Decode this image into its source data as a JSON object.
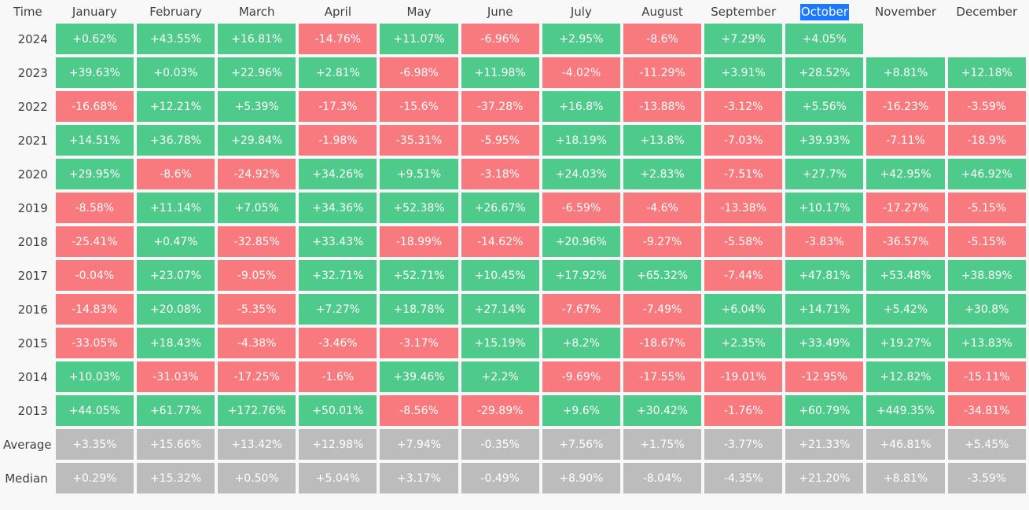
{
  "table": {
    "corner_label": "Time",
    "columns": [
      "January",
      "February",
      "March",
      "April",
      "May",
      "June",
      "July",
      "August",
      "September",
      "October",
      "November",
      "December"
    ],
    "highlighted_column": "October",
    "selection_color": "#1a79ff",
    "selection_text_color": "#ffffff",
    "positive_color": "#4ecb8a",
    "negative_color": "#f97a7e",
    "summary_color": "#bcbcbc",
    "background_color": "#f8f8f8",
    "rows": [
      {
        "label": "2024",
        "kind": "year",
        "values": [
          "+0.62%",
          "+43.55%",
          "+16.81%",
          "-14.76%",
          "+11.07%",
          "-6.96%",
          "+2.95%",
          "-8.6%",
          "+7.29%",
          "+4.05%",
          "",
          ""
        ]
      },
      {
        "label": "2023",
        "kind": "year",
        "values": [
          "+39.63%",
          "+0.03%",
          "+22.96%",
          "+2.81%",
          "-6.98%",
          "+11.98%",
          "-4.02%",
          "-11.29%",
          "+3.91%",
          "+28.52%",
          "+8.81%",
          "+12.18%"
        ]
      },
      {
        "label": "2022",
        "kind": "year",
        "values": [
          "-16.68%",
          "+12.21%",
          "+5.39%",
          "-17.3%",
          "-15.6%",
          "-37.28%",
          "+16.8%",
          "-13.88%",
          "-3.12%",
          "+5.56%",
          "-16.23%",
          "-3.59%"
        ]
      },
      {
        "label": "2021",
        "kind": "year",
        "values": [
          "+14.51%",
          "+36.78%",
          "+29.84%",
          "-1.98%",
          "-35.31%",
          "-5.95%",
          "+18.19%",
          "+13.8%",
          "-7.03%",
          "+39.93%",
          "-7.11%",
          "-18.9%"
        ]
      },
      {
        "label": "2020",
        "kind": "year",
        "values": [
          "+29.95%",
          "-8.6%",
          "-24.92%",
          "+34.26%",
          "+9.51%",
          "-3.18%",
          "+24.03%",
          "+2.83%",
          "-7.51%",
          "+27.7%",
          "+42.95%",
          "+46.92%"
        ]
      },
      {
        "label": "2019",
        "kind": "year",
        "values": [
          "-8.58%",
          "+11.14%",
          "+7.05%",
          "+34.36%",
          "+52.38%",
          "+26.67%",
          "-6.59%",
          "-4.6%",
          "-13.38%",
          "+10.17%",
          "-17.27%",
          "-5.15%"
        ]
      },
      {
        "label": "2018",
        "kind": "year",
        "values": [
          "-25.41%",
          "+0.47%",
          "-32.85%",
          "+33.43%",
          "-18.99%",
          "-14.62%",
          "+20.96%",
          "-9.27%",
          "-5.58%",
          "-3.83%",
          "-36.57%",
          "-5.15%"
        ]
      },
      {
        "label": "2017",
        "kind": "year",
        "values": [
          "-0.04%",
          "+23.07%",
          "-9.05%",
          "+32.71%",
          "+52.71%",
          "+10.45%",
          "+17.92%",
          "+65.32%",
          "-7.44%",
          "+47.81%",
          "+53.48%",
          "+38.89%"
        ]
      },
      {
        "label": "2016",
        "kind": "year",
        "values": [
          "-14.83%",
          "+20.08%",
          "-5.35%",
          "+7.27%",
          "+18.78%",
          "+27.14%",
          "-7.67%",
          "-7.49%",
          "+6.04%",
          "+14.71%",
          "+5.42%",
          "+30.8%"
        ]
      },
      {
        "label": "2015",
        "kind": "year",
        "values": [
          "-33.05%",
          "+18.43%",
          "-4.38%",
          "-3.46%",
          "-3.17%",
          "+15.19%",
          "+8.2%",
          "-18.67%",
          "+2.35%",
          "+33.49%",
          "+19.27%",
          "+13.83%"
        ]
      },
      {
        "label": "2014",
        "kind": "year",
        "values": [
          "+10.03%",
          "-31.03%",
          "-17.25%",
          "-1.6%",
          "+39.46%",
          "+2.2%",
          "-9.69%",
          "-17.55%",
          "-19.01%",
          "-12.95%",
          "+12.82%",
          "-15.11%"
        ]
      },
      {
        "label": "2013",
        "kind": "year",
        "values": [
          "+44.05%",
          "+61.77%",
          "+172.76%",
          "+50.01%",
          "-8.56%",
          "-29.89%",
          "+9.6%",
          "+30.42%",
          "-1.76%",
          "+60.79%",
          "+449.35%",
          "-34.81%"
        ]
      },
      {
        "label": "Average",
        "kind": "summary",
        "values": [
          "+3.35%",
          "+15.66%",
          "+13.42%",
          "+12.98%",
          "+7.94%",
          "-0.35%",
          "+7.56%",
          "+1.75%",
          "-3.77%",
          "+21.33%",
          "+46.81%",
          "+5.45%"
        ]
      },
      {
        "label": "Median",
        "kind": "summary",
        "values": [
          "+0.29%",
          "+15.32%",
          "+0.50%",
          "+5.04%",
          "+3.17%",
          "-0.49%",
          "+8.90%",
          "-8.04%",
          "-4.35%",
          "+21.20%",
          "+8.81%",
          "-3.59%"
        ]
      }
    ]
  },
  "chart_data": {
    "type": "heatmap",
    "title": "",
    "xlabel": "",
    "ylabel": "Time",
    "categories": [
      "January",
      "February",
      "March",
      "April",
      "May",
      "June",
      "July",
      "August",
      "September",
      "October",
      "November",
      "December"
    ],
    "row_labels": [
      "2024",
      "2023",
      "2022",
      "2021",
      "2020",
      "2019",
      "2018",
      "2017",
      "2016",
      "2015",
      "2014",
      "2013",
      "Average",
      "Median"
    ],
    "unit": "percent",
    "series": [
      {
        "name": "2024",
        "values": [
          0.62,
          43.55,
          16.81,
          -14.76,
          11.07,
          -6.96,
          2.95,
          -8.6,
          7.29,
          4.05,
          null,
          null
        ]
      },
      {
        "name": "2023",
        "values": [
          39.63,
          0.03,
          22.96,
          2.81,
          -6.98,
          11.98,
          -4.02,
          -11.29,
          3.91,
          28.52,
          8.81,
          12.18
        ]
      },
      {
        "name": "2022",
        "values": [
          -16.68,
          12.21,
          5.39,
          -17.3,
          -15.6,
          -37.28,
          16.8,
          -13.88,
          -3.12,
          5.56,
          -16.23,
          -3.59
        ]
      },
      {
        "name": "2021",
        "values": [
          14.51,
          36.78,
          29.84,
          -1.98,
          -35.31,
          -5.95,
          18.19,
          13.8,
          -7.03,
          39.93,
          -7.11,
          -18.9
        ]
      },
      {
        "name": "2020",
        "values": [
          29.95,
          -8.6,
          -24.92,
          34.26,
          9.51,
          -3.18,
          24.03,
          2.83,
          -7.51,
          27.7,
          42.95,
          46.92
        ]
      },
      {
        "name": "2019",
        "values": [
          -8.58,
          11.14,
          7.05,
          34.36,
          52.38,
          26.67,
          -6.59,
          -4.6,
          -13.38,
          10.17,
          -17.27,
          -5.15
        ]
      },
      {
        "name": "2018",
        "values": [
          -25.41,
          0.47,
          -32.85,
          33.43,
          -18.99,
          -14.62,
          20.96,
          -9.27,
          -5.58,
          -3.83,
          -36.57,
          -5.15
        ]
      },
      {
        "name": "2017",
        "values": [
          -0.04,
          23.07,
          -9.05,
          32.71,
          52.71,
          10.45,
          17.92,
          65.32,
          -7.44,
          47.81,
          53.48,
          38.89
        ]
      },
      {
        "name": "2016",
        "values": [
          -14.83,
          20.08,
          -5.35,
          7.27,
          18.78,
          27.14,
          -7.67,
          -7.49,
          6.04,
          14.71,
          5.42,
          30.8
        ]
      },
      {
        "name": "2015",
        "values": [
          -33.05,
          18.43,
          -4.38,
          -3.46,
          -3.17,
          15.19,
          8.2,
          -18.67,
          2.35,
          33.49,
          19.27,
          13.83
        ]
      },
      {
        "name": "2014",
        "values": [
          10.03,
          -31.03,
          -17.25,
          -1.6,
          39.46,
          2.2,
          -9.69,
          -17.55,
          -19.01,
          -12.95,
          12.82,
          -15.11
        ]
      },
      {
        "name": "2013",
        "values": [
          44.05,
          61.77,
          172.76,
          50.01,
          -8.56,
          -29.89,
          9.6,
          30.42,
          -1.76,
          60.79,
          449.35,
          -34.81
        ]
      },
      {
        "name": "Average",
        "values": [
          3.35,
          15.66,
          13.42,
          12.98,
          7.94,
          -0.35,
          7.56,
          1.75,
          -3.77,
          21.33,
          46.81,
          5.45
        ]
      },
      {
        "name": "Median",
        "values": [
          0.29,
          15.32,
          0.5,
          5.04,
          3.17,
          -0.49,
          8.9,
          -8.04,
          -4.35,
          21.2,
          8.81,
          -3.59
        ]
      }
    ],
    "colorscale": {
      "positive": "#4ecb8a",
      "negative": "#f97a7e",
      "summary": "#bcbcbc"
    },
    "legend": "none",
    "grid": false
  }
}
